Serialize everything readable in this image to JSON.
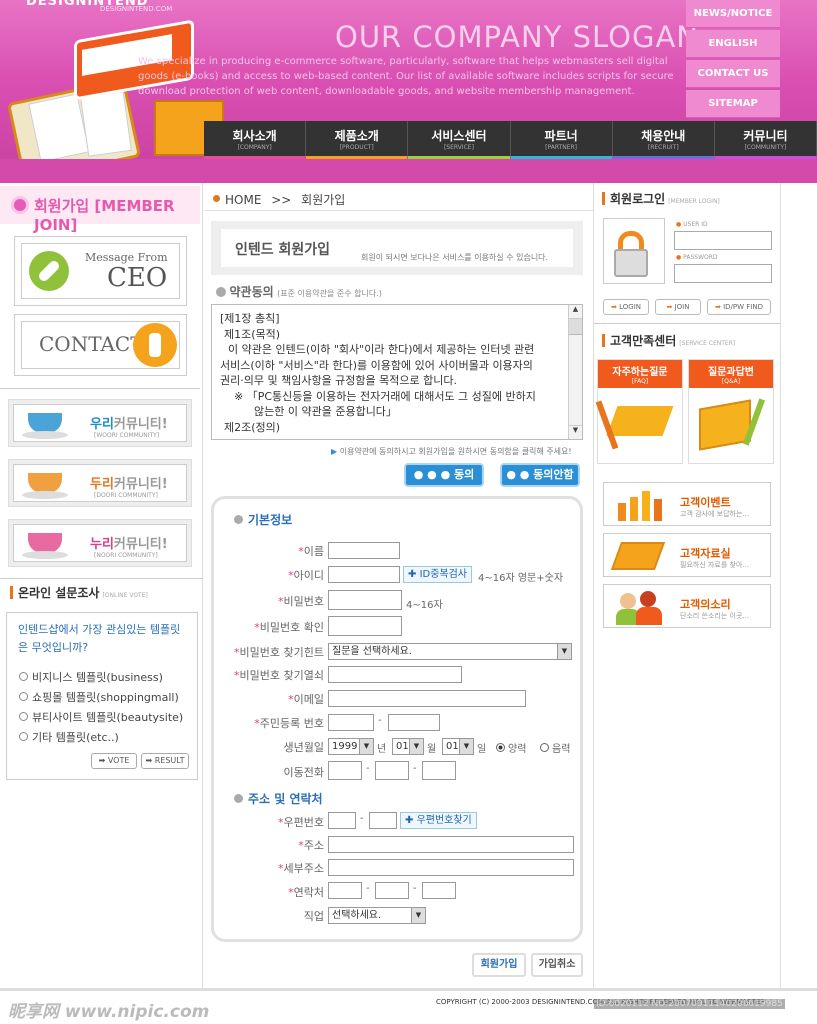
{
  "header": {
    "logo": "DESIGNINTEND",
    "logo_sub": "DESIGNINTEND.COM",
    "slogan": "OUR COMPANY SLOGAN",
    "slogan_desc": "We specialize in producing e-commerce software, particularly, software that helps webmasters sell digital goods (e-books) and access to web-based content. Our list of available software includes scripts for secure download protection of web content, downloadable goods, and website membership management.",
    "top_links": [
      "NEWS/NOTICE",
      "ENGLISH",
      "CONTACT US",
      "SITEMAP"
    ],
    "nav": [
      {
        "label": "회사소개",
        "sub": "[COMPANY]",
        "color": "#e84b9b"
      },
      {
        "label": "제품소개",
        "sub": "[PRODUCT]",
        "color": "#f2a21c"
      },
      {
        "label": "서비스센터",
        "sub": "[SERVICE]",
        "color": "#9bd13a"
      },
      {
        "label": "파트너",
        "sub": "[PARTNER]",
        "color": "#2fb7d8"
      },
      {
        "label": "채용안내",
        "sub": "[RECRUIT]",
        "color": "#6a6ee0"
      },
      {
        "label": "커뮤니티",
        "sub": "[COMMUNITY]",
        "color": "#c84ee0"
      }
    ]
  },
  "left": {
    "title": "회원가입 [MEMBER JOIN]",
    "ceo": {
      "small": "Message From",
      "big": "CEO"
    },
    "contact": "CONTACT",
    "communities": [
      {
        "pre": "우리",
        "rest": "커뮤니티!",
        "sub": "[WOORI COMMUNITY]",
        "color": "#1c8fc9",
        "cup": "#4aa4d8"
      },
      {
        "pre": "두리",
        "rest": "커뮤니티!",
        "sub": "[DOORI COMMUNITY]",
        "color": "#e8741c",
        "cup": "#f0a040"
      },
      {
        "pre": "누리",
        "rest": "커뮤니티!",
        "sub": "[NOORI COMMUNITY]",
        "color": "#e03c8a",
        "cup": "#e86aa0"
      }
    ],
    "vote": {
      "title": "온라인 설문조사",
      "title_sub": "[ONLINE VOTE]",
      "question": "인텐드샵에서 가장 관심있는 템플릿은 무엇입니까?",
      "options": [
        "비지니스 템플릿(business)",
        "쇼핑몰 템플릿(shoppingmall)",
        "뷰티사이트 템플릿(beautysite)",
        "기타 템플릿(etc..)"
      ],
      "vote_btn": "VOTE",
      "result_btn": "RESULT"
    }
  },
  "main": {
    "breadcrumb_home": "HOME",
    "breadcrumb_sep": ">>",
    "breadcrumb_current": "회원가입",
    "page_title": "인텐드 회원가입",
    "page_desc": "회원이 되시면 보다나은 서비스를 이용하실 수 있습니다.",
    "terms_title": "약관동의",
    "terms_sub": "(표준 이용약관을 준수 합니다.)",
    "terms_lines": [
      "[제1장  총칙]",
      "제1조(목적)",
      "이 약관은 인텐드(이하 \"회사\"이라 한다)에서 제공하는 인터넷 관련",
      "서비스(이하 \"서비스\"라 한다)를 이용함에 있어 사이버몰과 이용자의",
      "권리·의무 및 책임사항을 규정함을 목적으로 합니다.",
      "※ 「PC통신등을 이용하는 전자거래에 대해서도 그 성질에 반하지",
      "않는한 이 약관을 준용합니다」",
      "제2조(정의)"
    ],
    "agree_notice": "이용약관에 동의하시고 회원가입을 원하시면 동의함을 클릭해 주세요!",
    "agree_btn": "동의",
    "disagree_btn": "동의안함",
    "basic_title": "기본정보",
    "fields": {
      "name": "이름",
      "id": "아이디",
      "id_check": "ID중복검사",
      "id_hint": "4~16자 영문+숫자",
      "pw": "비밀번호",
      "pw_hint": "4~16자",
      "pw_confirm": "비밀번호 확인",
      "pw_hint_q": "비밀번호 찾기힌트",
      "pw_hint_q_value": "질문을 선택하세요.",
      "pw_hint_a": "비밀번호 찾기열쇠",
      "email": "이메일",
      "ssn": "주민등록 번호",
      "birth": "생년월일",
      "birth_year": "1999",
      "birth_year_unit": "년",
      "birth_month": "01",
      "birth_month_unit": "월",
      "birth_day": "01",
      "birth_day_unit": "일",
      "solar": "양력",
      "lunar": "음력",
      "mobile": "이동전화"
    },
    "address_title": "주소 및 연락처",
    "addr": {
      "zip": "우편번호",
      "zip_btn": "우편번호찾기",
      "addr": "주소",
      "addr_detail": "세부주소",
      "phone": "연락처",
      "job": "직업",
      "job_value": "선택하세요."
    },
    "join_btn": "회원가입",
    "cancel_btn": "가입취소"
  },
  "right": {
    "login_title": "회원로그인",
    "login_sub": "[MEMBER LOGIN]",
    "user_id": "USER ID",
    "password": "PASSWORD",
    "login_btn": "LOGIN",
    "join_btn": "JOIN",
    "find_btn": "ID/PW FIND",
    "cs_title": "고객만족센터",
    "cs_sub": "[SERVICE CENTER]",
    "faq": "자주하는질문",
    "faq_sub": "[FAQ]",
    "qna": "질문과답변",
    "qna_sub": "[Q&A]",
    "boxes": [
      {
        "title": "고객이벤트",
        "desc": "고객 감사에 보답하는..."
      },
      {
        "title": "고객자료실",
        "desc": "필요하신 자료를 찾아..."
      },
      {
        "title": "고객의소리",
        "desc": "단소리 쓴소리는 이곳..."
      }
    ]
  },
  "footer": {
    "copyright": "COPYRIGHT (C) 2000-2003 DESIGNINTEND.COM  ALL RIGHTS RESERVED  MAIL TO WEBMASTER",
    "watermark": "昵享网 www.nipic.com",
    "watermark_id": "ID:6020112 NO:20070911140206619985"
  }
}
